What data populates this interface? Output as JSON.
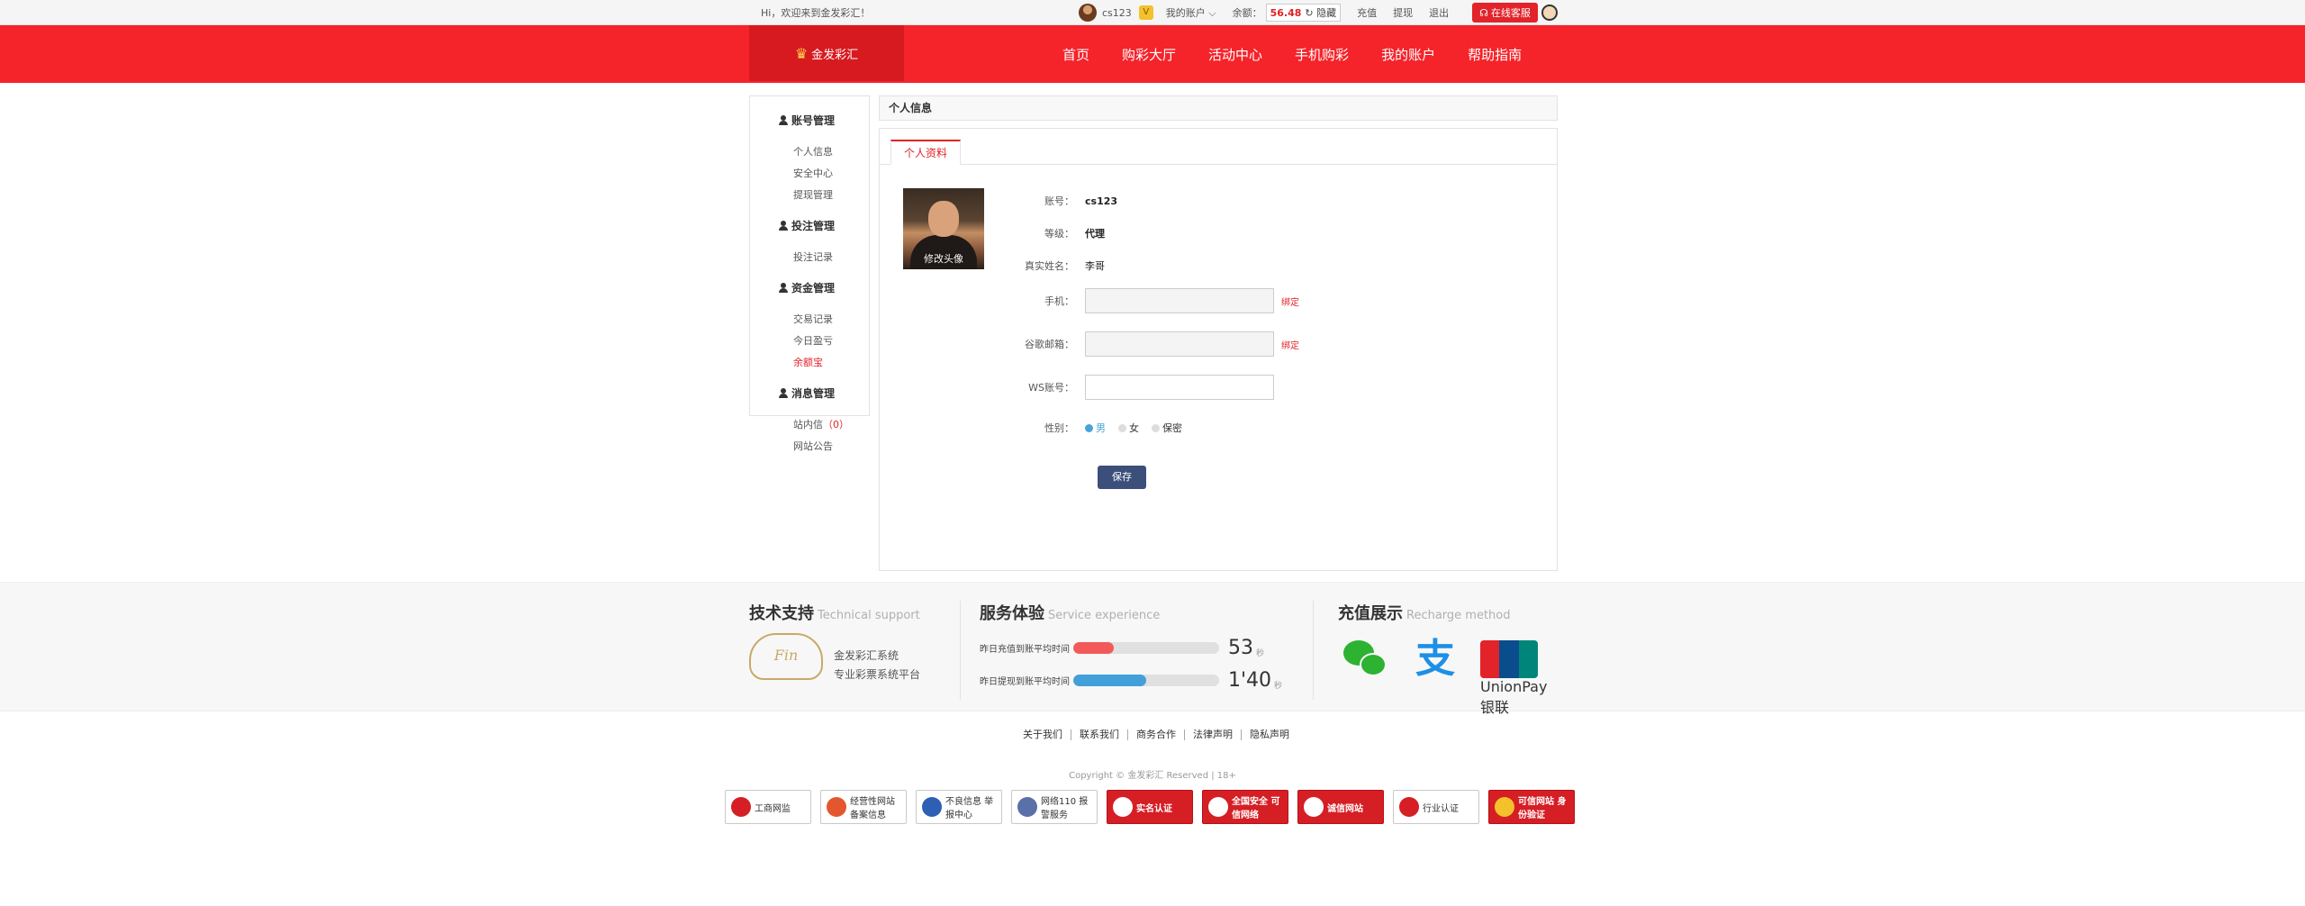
{
  "topbar": {
    "greeting": "Hi，欢迎来到金发彩汇！",
    "username": "cs123",
    "vip": "V",
    "my_account": "我的账户",
    "my_account_caret": "⌵",
    "balance_label": "余额：",
    "balance_value": "56.48",
    "refresh_icon": "↻",
    "hide_label": "隐藏",
    "recharge": "充值",
    "withdraw": "提现",
    "logout": "退出",
    "service": "在线客服",
    "headset_icon": "☊"
  },
  "header": {
    "logo_text": "金发彩汇",
    "logo_icon": "♛",
    "nav": [
      "首页",
      "购彩大厅",
      "活动中心",
      "手机购彩",
      "我的账户",
      "帮助指南"
    ]
  },
  "sidebar": {
    "groups": [
      {
        "title": "账号管理",
        "items": [
          "个人信息",
          "安全中心",
          "提现管理"
        ]
      },
      {
        "title": "投注管理",
        "items": [
          "投注记录"
        ]
      },
      {
        "title": "资金管理",
        "items": [
          "交易记录",
          "今日盈亏",
          "余额宝"
        ]
      },
      {
        "title": "消息管理",
        "items": [
          "站内信",
          "网站公告"
        ]
      }
    ],
    "inbox_count_open": "（",
    "inbox_count": "0",
    "inbox_count_close": "）"
  },
  "main": {
    "panel_title": "个人信息",
    "tab": "个人资料",
    "photo_label": "修改头像",
    "fields": {
      "account_label": "账号：",
      "account_value": "cs123",
      "level_label": "等级：",
      "level_value": "代理",
      "realname_label": "真实姓名：",
      "realname_value": "李哥",
      "phone_label": "手机：",
      "phone_value": "",
      "phone_bind": "绑定",
      "email_label": "谷歌邮箱：",
      "email_value": "",
      "email_bind": "绑定",
      "ws_label": "WS账号：",
      "ws_value": "",
      "gender_label": "性别：",
      "gender_options": [
        "男",
        "女",
        "保密"
      ]
    },
    "save": "保存"
  },
  "support": {
    "tech_title": "技术支持",
    "tech_en": "Technical support",
    "tech_line1": "金发彩汇系统",
    "tech_line2": "专业彩票系统平台",
    "logo_text": "Fin",
    "service_title": "服务体验",
    "service_en": "Service experience",
    "stats": [
      {
        "label": "昨日充值到账平均时间",
        "value": "53",
        "unit": "秒",
        "fill": 0.28,
        "color": "#f25a5a"
      },
      {
        "label": "昨日提现到账平均时间",
        "value": "1'40",
        "unit": "秒",
        "fill": 0.5,
        "color": "#42a0d8"
      }
    ],
    "recharge_title": "充值展示",
    "recharge_en": "Recharge method",
    "alipay_glyph": "支",
    "unionpay_text": "UnionPay 银联"
  },
  "footer": {
    "links": [
      "关于我们",
      "联系我们",
      "商务合作",
      "法律声明",
      "隐私声明"
    ],
    "copyright": "Copyright © 金发彩汇 Reserved | 18+",
    "badges": [
      {
        "text": "工商网监",
        "style": "plain",
        "icon_color": "#d61e25"
      },
      {
        "text": "经营性网站 备案信息",
        "style": "plain",
        "icon_color": "#e4572e"
      },
      {
        "text": "不良信息 举报中心",
        "style": "plain",
        "icon_color": "#2d5fb4"
      },
      {
        "text": "网络110 报警服务",
        "style": "plain",
        "icon_color": "#5b6fa8"
      },
      {
        "text": "实名认证",
        "style": "red",
        "icon_color": "#ffffff"
      },
      {
        "text": "全国安全 可信网络",
        "style": "red",
        "icon_color": "#ffffff"
      },
      {
        "text": "诚信网站",
        "style": "red",
        "icon_color": "#ffffff"
      },
      {
        "text": "行业认证",
        "style": "plain",
        "icon_color": "#d61e25"
      },
      {
        "text": "可信网站 身份验证",
        "style": "red",
        "icon_color": "#f3c12b"
      }
    ]
  }
}
